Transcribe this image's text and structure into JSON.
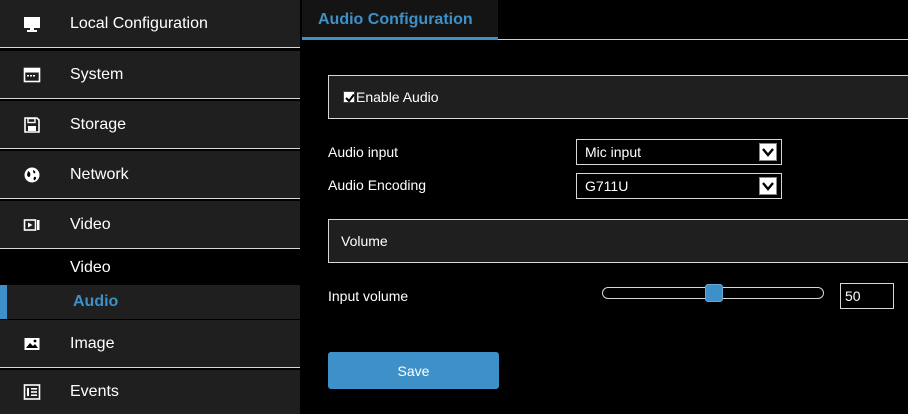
{
  "sidebar": {
    "items": [
      {
        "label": "Local Configuration",
        "icon": "monitor-icon"
      },
      {
        "label": "System",
        "icon": "system-window-icon"
      },
      {
        "label": "Storage",
        "icon": "floppy-disk-icon"
      },
      {
        "label": "Network",
        "icon": "globe-icon"
      },
      {
        "label": "Video",
        "icon": "video-camera-icon"
      }
    ],
    "sub_items": [
      {
        "label": "Video",
        "active": false
      },
      {
        "label": "Audio",
        "active": true
      }
    ],
    "items_after": [
      {
        "label": "Image",
        "icon": "image-icon"
      },
      {
        "label": "Events",
        "icon": "events-list-icon"
      }
    ]
  },
  "main": {
    "tab": "Audio Configuration",
    "enable_audio": {
      "label": "Enable Audio",
      "checked": true
    },
    "audio_input": {
      "label": "Audio input",
      "value": "Mic input"
    },
    "audio_encoding": {
      "label": "Audio Encoding",
      "value": "G711U"
    },
    "volume_section": "Volume",
    "input_volume": {
      "label": "Input volume",
      "value": "50"
    },
    "save_label": "Save"
  },
  "colors": {
    "accent": "#3d91c8",
    "panel": "#1f1f1f",
    "background": "#000000"
  }
}
